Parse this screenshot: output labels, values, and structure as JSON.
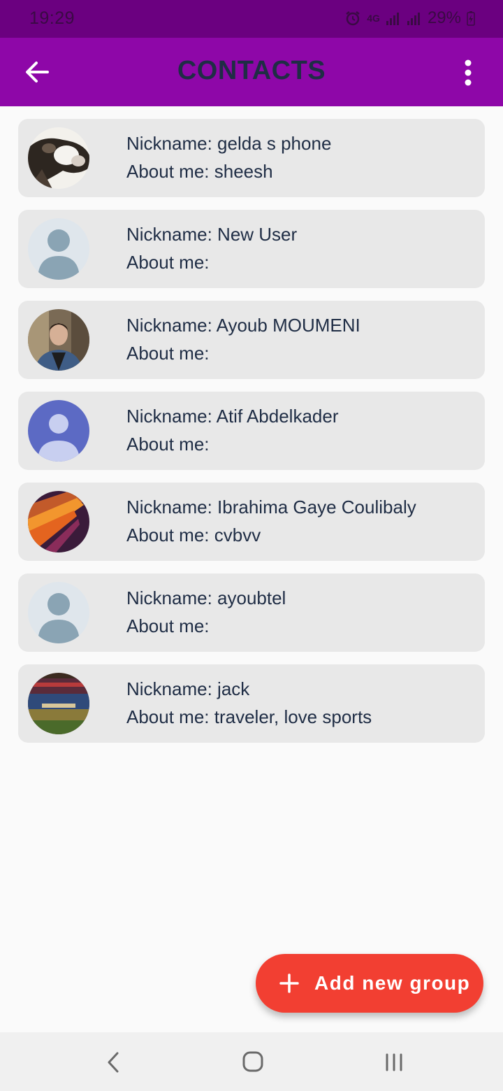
{
  "status_bar": {
    "time": "19:29",
    "network": "4G",
    "battery": "29%"
  },
  "app_bar": {
    "title": "CONTACTS"
  },
  "contacts": [
    {
      "nickname": "Nickname: gelda s phone",
      "about": "About me: sheesh",
      "avatar": "cow-photo"
    },
    {
      "nickname": "Nickname: New User",
      "about": "About me:",
      "avatar": "default-person-grey"
    },
    {
      "nickname": "Nickname: Ayoub MOUMENI",
      "about": "About me:",
      "avatar": "person-photo"
    },
    {
      "nickname": "Nickname: Atif Abdelkader",
      "about": "About me:",
      "avatar": "default-person-blue"
    },
    {
      "nickname": "Nickname: Ibrahima Gaye Coulibaly",
      "about": "About me: cvbvv",
      "avatar": "abstract-photo"
    },
    {
      "nickname": "Nickname: ayoubtel",
      "about": "About me:",
      "avatar": "default-person-grey"
    },
    {
      "nickname": "Nickname: jack",
      "about": "About me: traveler, love sports",
      "avatar": "stadium-photo"
    }
  ],
  "fab": {
    "label": "Add new group"
  },
  "colors": {
    "status_bar": "#6b0080",
    "app_bar": "#8e07a8",
    "card": "#e8e8e8",
    "text": "#1f2d45",
    "fab": "#f23f32"
  }
}
